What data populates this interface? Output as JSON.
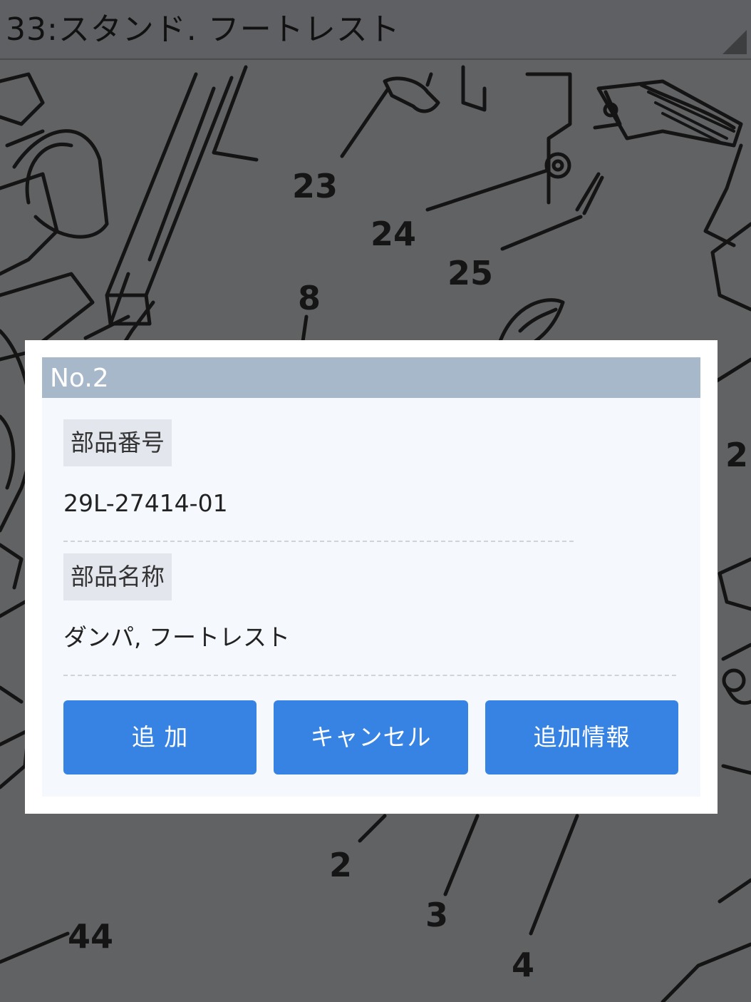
{
  "header": {
    "title": "33:スタンド. フートレスト"
  },
  "diagram": {
    "labels": [
      "23",
      "24",
      "25",
      "8",
      "2",
      "2",
      "3",
      "44",
      "4"
    ]
  },
  "modal": {
    "title": "No.2",
    "part_number_label": "部品番号",
    "part_number_value": "29L-27414-01",
    "part_name_label": "部品名称",
    "part_name_value": "ダンパ, フートレスト",
    "buttons": {
      "add": "追 加",
      "cancel": "キャンセル",
      "more_info": "追加情報"
    }
  }
}
